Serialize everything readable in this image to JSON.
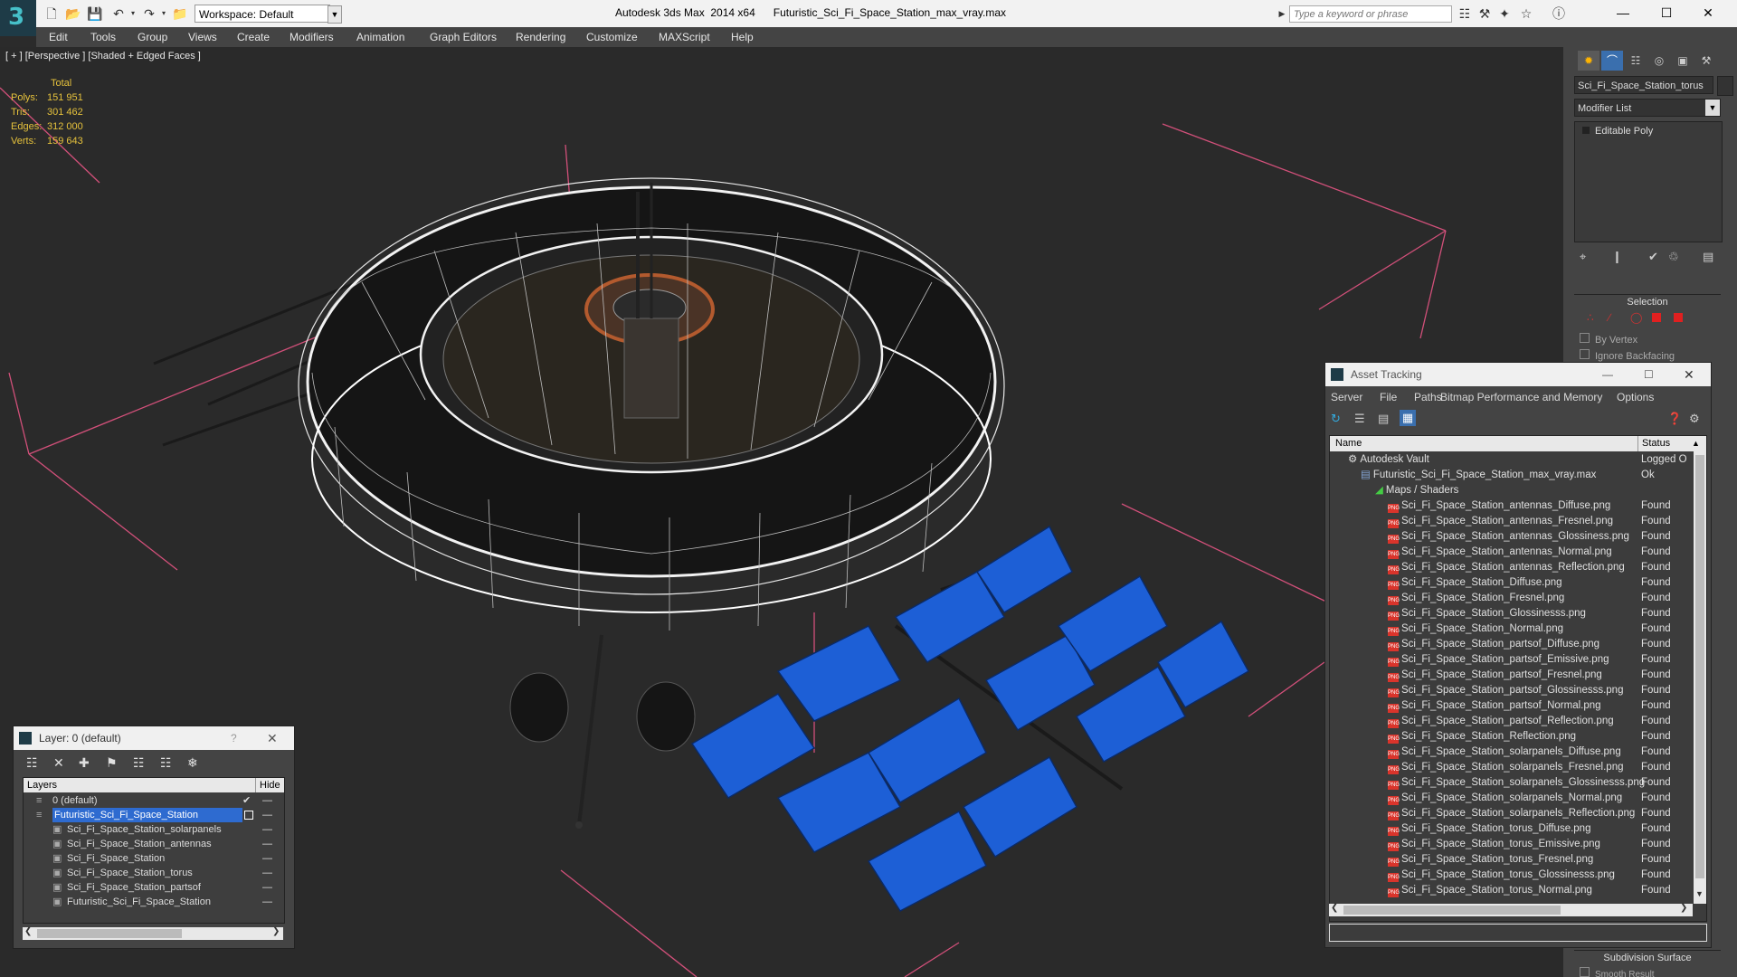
{
  "titlebar": {
    "workspace": "Workspace: Default",
    "app_title": "Autodesk 3ds Max  2014 x64",
    "file_title": "Futuristic_Sci_Fi_Space_Station_max_vray.max",
    "search_placeholder": "Type a keyword or phrase"
  },
  "menubar": [
    "Edit",
    "Tools",
    "Group",
    "Views",
    "Create",
    "Modifiers",
    "Animation",
    "Graph Editors",
    "Rendering",
    "Customize",
    "MAXScript",
    "Help"
  ],
  "viewport": {
    "label": "[ + ] [Perspective ] [Shaded + Edged Faces ]",
    "stats": {
      "header": "Total",
      "rows": [
        {
          "label": "Polys:",
          "value": "151 951"
        },
        {
          "label": "Tris:",
          "value": "301 462"
        },
        {
          "label": "Edges:",
          "value": "312 000"
        },
        {
          "label": "Verts:",
          "value": "159 643"
        }
      ]
    }
  },
  "command_panel": {
    "object_name": "Sci_Fi_Space_Station_torus",
    "modifier_list": "Modifier List",
    "stack_item": "Editable Poly",
    "selection_title": "Selection",
    "by_vertex": "By Vertex",
    "ignore_backfacing": "Ignore Backfacing",
    "subdivision_title": "Subdivision Surface",
    "smooth_result": "Smooth Result"
  },
  "layer_panel": {
    "title": "Layer: 0 (default)",
    "help": "?",
    "col_layers": "Layers",
    "col_hide": "Hide",
    "rows": [
      {
        "name": "0 (default)",
        "indent": 1
      },
      {
        "name": "Futuristic_Sci_Fi_Space_Station",
        "indent": 1
      },
      {
        "name": "Sci_Fi_Space_Station_solarpanels",
        "indent": 2
      },
      {
        "name": "Sci_Fi_Space_Station_antennas",
        "indent": 2
      },
      {
        "name": "Sci_Fi_Space_Station",
        "indent": 2
      },
      {
        "name": "Sci_Fi_Space_Station_torus",
        "indent": 2
      },
      {
        "name": "Sci_Fi_Space_Station_partsof",
        "indent": 2
      },
      {
        "name": "Futuristic_Sci_Fi_Space_Station",
        "indent": 2
      }
    ]
  },
  "asset_panel": {
    "title": "Asset Tracking",
    "menu": [
      "Server",
      "File",
      "Paths",
      "Bitmap Performance and Memory",
      "Options"
    ],
    "col_name": "Name",
    "col_status": "Status",
    "rows": [
      {
        "name": "Autodesk Vault",
        "status": "Logged O",
        "level": 1
      },
      {
        "name": "Futuristic_Sci_Fi_Space_Station_max_vray.max",
        "status": "Ok",
        "level": 2
      },
      {
        "name": "Maps / Shaders",
        "status": "",
        "level": 3
      },
      {
        "name": "Sci_Fi_Space_Station_antennas_Diffuse.png",
        "status": "Found",
        "level": 4
      },
      {
        "name": "Sci_Fi_Space_Station_antennas_Fresnel.png",
        "status": "Found",
        "level": 4
      },
      {
        "name": "Sci_Fi_Space_Station_antennas_Glossiness.png",
        "status": "Found",
        "level": 4
      },
      {
        "name": "Sci_Fi_Space_Station_antennas_Normal.png",
        "status": "Found",
        "level": 4
      },
      {
        "name": "Sci_Fi_Space_Station_antennas_Reflection.png",
        "status": "Found",
        "level": 4
      },
      {
        "name": "Sci_Fi_Space_Station_Diffuse.png",
        "status": "Found",
        "level": 4
      },
      {
        "name": "Sci_Fi_Space_Station_Fresnel.png",
        "status": "Found",
        "level": 4
      },
      {
        "name": "Sci_Fi_Space_Station_Glossinesss.png",
        "status": "Found",
        "level": 4
      },
      {
        "name": "Sci_Fi_Space_Station_Normal.png",
        "status": "Found",
        "level": 4
      },
      {
        "name": "Sci_Fi_Space_Station_partsof_Diffuse.png",
        "status": "Found",
        "level": 4
      },
      {
        "name": "Sci_Fi_Space_Station_partsof_Emissive.png",
        "status": "Found",
        "level": 4
      },
      {
        "name": "Sci_Fi_Space_Station_partsof_Fresnel.png",
        "status": "Found",
        "level": 4
      },
      {
        "name": "Sci_Fi_Space_Station_partsof_Glossinesss.png",
        "status": "Found",
        "level": 4
      },
      {
        "name": "Sci_Fi_Space_Station_partsof_Normal.png",
        "status": "Found",
        "level": 4
      },
      {
        "name": "Sci_Fi_Space_Station_partsof_Reflection.png",
        "status": "Found",
        "level": 4
      },
      {
        "name": "Sci_Fi_Space_Station_Reflection.png",
        "status": "Found",
        "level": 4
      },
      {
        "name": "Sci_Fi_Space_Station_solarpanels_Diffuse.png",
        "status": "Found",
        "level": 4
      },
      {
        "name": "Sci_Fi_Space_Station_solarpanels_Fresnel.png",
        "status": "Found",
        "level": 4
      },
      {
        "name": "Sci_Fi_Space_Station_solarpanels_Glossinesss.png",
        "status": "Found",
        "level": 4
      },
      {
        "name": "Sci_Fi_Space_Station_solarpanels_Normal.png",
        "status": "Found",
        "level": 4
      },
      {
        "name": "Sci_Fi_Space_Station_solarpanels_Reflection.png",
        "status": "Found",
        "level": 4
      },
      {
        "name": "Sci_Fi_Space_Station_torus_Diffuse.png",
        "status": "Found",
        "level": 4
      },
      {
        "name": "Sci_Fi_Space_Station_torus_Emissive.png",
        "status": "Found",
        "level": 4
      },
      {
        "name": "Sci_Fi_Space_Station_torus_Fresnel.png",
        "status": "Found",
        "level": 4
      },
      {
        "name": "Sci_Fi_Space_Station_torus_Glossinesss.png",
        "status": "Found",
        "level": 4
      },
      {
        "name": "Sci_Fi_Space_Station_torus_Normal.png",
        "status": "Found",
        "level": 4
      }
    ]
  },
  "icons": {
    "app_logo": "3ds-max-logo-icon",
    "png_badge": "PNG"
  },
  "colors": {
    "selection_blue": "#2e6bd0",
    "stats_yellow": "#e6c23c",
    "solar_blue": "#1d5fd6",
    "gizmo_pink": "#d2507a"
  }
}
